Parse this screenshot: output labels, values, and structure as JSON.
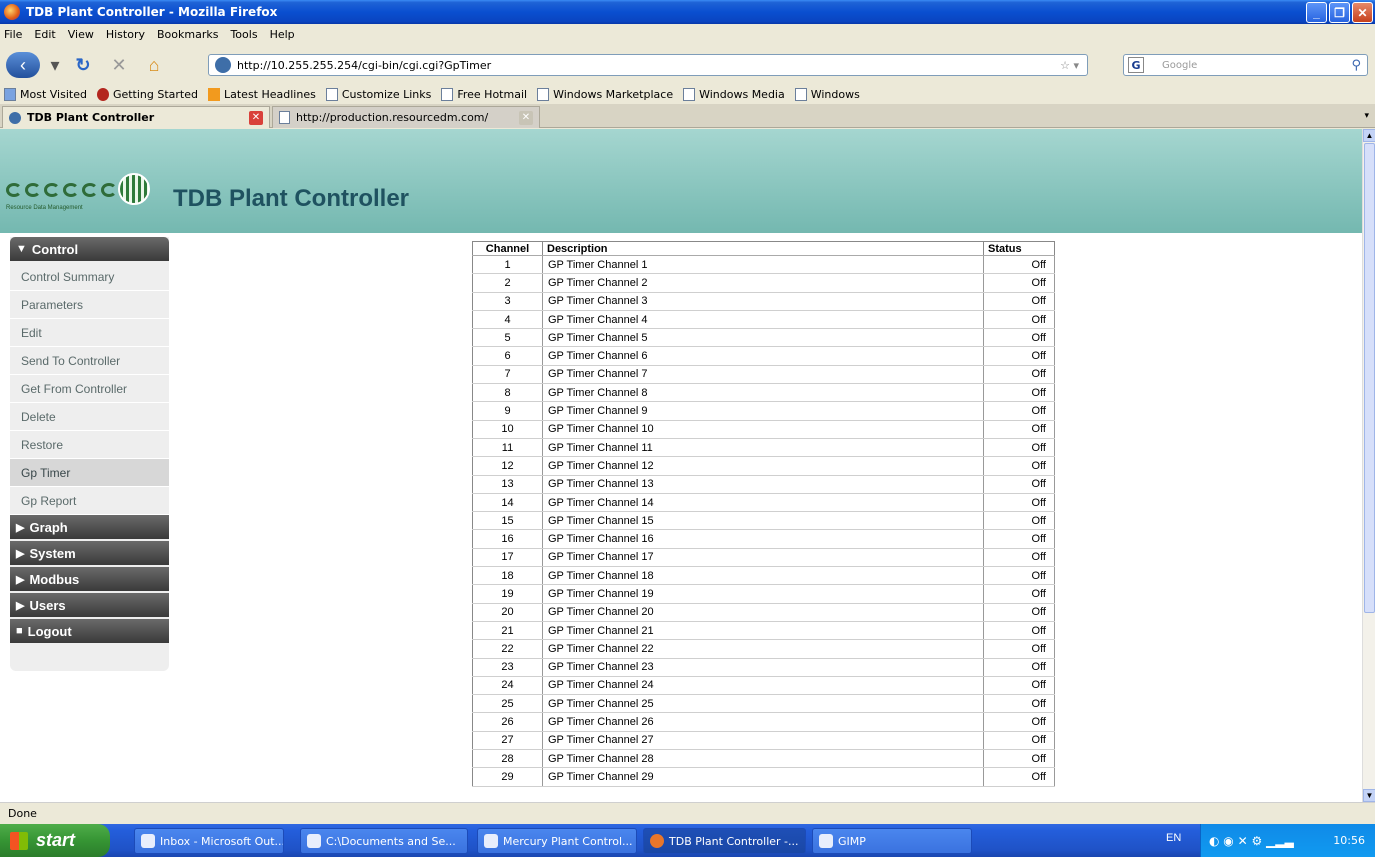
{
  "window": {
    "title": "TDB Plant Controller - Mozilla Firefox"
  },
  "menu": [
    "File",
    "Edit",
    "View",
    "History",
    "Bookmarks",
    "Tools",
    "Help"
  ],
  "nav": {
    "url": "http://10.255.255.254/cgi-bin/cgi.cgi?GpTimer",
    "search_placeholder": "Google"
  },
  "bookmarks": [
    "Most Visited",
    "Getting Started",
    "Latest Headlines",
    "Customize Links",
    "Free Hotmail",
    "Windows Marketplace",
    "Windows Media",
    "Windows"
  ],
  "tabs": [
    {
      "label": "TDB Plant Controller",
      "active": true
    },
    {
      "label": "http://production.resourcedm.com/",
      "active": false
    }
  ],
  "site": {
    "title": "TDB Plant Controller",
    "logo_tagline": "Resource Data Management"
  },
  "sidebar": {
    "control_header": "Control",
    "items": [
      "Control Summary",
      "Parameters",
      "Edit",
      "Send To Controller",
      "Get From Controller",
      "Delete",
      "Restore",
      "Gp Timer",
      "Gp Report"
    ],
    "selected": "Gp Timer",
    "sections": [
      "Graph",
      "System",
      "Modbus",
      "Users",
      "Logout"
    ]
  },
  "table": {
    "headers": {
      "channel": "Channel",
      "description": "Description",
      "status": "Status"
    },
    "rows": [
      [
        "1",
        "GP Timer Channel 1",
        "Off"
      ],
      [
        "2",
        "GP Timer Channel 2",
        "Off"
      ],
      [
        "3",
        "GP Timer Channel 3",
        "Off"
      ],
      [
        "4",
        "GP Timer Channel 4",
        "Off"
      ],
      [
        "5",
        "GP Timer Channel 5",
        "Off"
      ],
      [
        "6",
        "GP Timer Channel 6",
        "Off"
      ],
      [
        "7",
        "GP Timer Channel 7",
        "Off"
      ],
      [
        "8",
        "GP Timer Channel 8",
        "Off"
      ],
      [
        "9",
        "GP Timer Channel 9",
        "Off"
      ],
      [
        "10",
        "GP Timer Channel 10",
        "Off"
      ],
      [
        "11",
        "GP Timer Channel 11",
        "Off"
      ],
      [
        "12",
        "GP Timer Channel 12",
        "Off"
      ],
      [
        "13",
        "GP Timer Channel 13",
        "Off"
      ],
      [
        "14",
        "GP Timer Channel 14",
        "Off"
      ],
      [
        "15",
        "GP Timer Channel 15",
        "Off"
      ],
      [
        "16",
        "GP Timer Channel 16",
        "Off"
      ],
      [
        "17",
        "GP Timer Channel 17",
        "Off"
      ],
      [
        "18",
        "GP Timer Channel 18",
        "Off"
      ],
      [
        "19",
        "GP Timer Channel 19",
        "Off"
      ],
      [
        "20",
        "GP Timer Channel 20",
        "Off"
      ],
      [
        "21",
        "GP Timer Channel 21",
        "Off"
      ],
      [
        "22",
        "GP Timer Channel 22",
        "Off"
      ],
      [
        "23",
        "GP Timer Channel 23",
        "Off"
      ],
      [
        "24",
        "GP Timer Channel 24",
        "Off"
      ],
      [
        "25",
        "GP Timer Channel 25",
        "Off"
      ],
      [
        "26",
        "GP Timer Channel 26",
        "Off"
      ],
      [
        "27",
        "GP Timer Channel 27",
        "Off"
      ],
      [
        "28",
        "GP Timer Channel 28",
        "Off"
      ],
      [
        "29",
        "GP Timer Channel 29",
        "Off"
      ]
    ]
  },
  "status_bar": "Done",
  "taskbar": {
    "start": "start",
    "tasks": [
      "Inbox - Microsoft Out...",
      "C:\\Documents and Se...",
      "Mercury Plant Control...",
      "TDB Plant Controller -...",
      "GIMP"
    ],
    "active_task": "TDB Plant Controller -...",
    "language": "EN",
    "clock": "10:56"
  },
  "colors": {
    "header_teal": "#8ccac3",
    "title_text": "#1f5260",
    "sidebar_dark": "#4a4a4a"
  }
}
